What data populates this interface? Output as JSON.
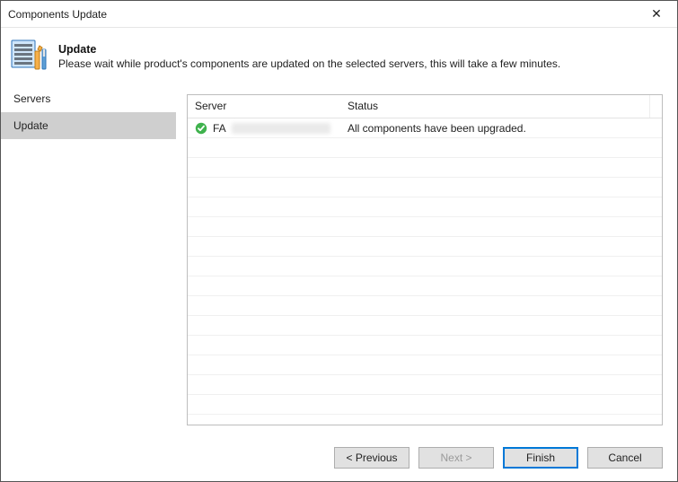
{
  "window": {
    "title": "Components Update"
  },
  "header": {
    "title": "Update",
    "subtitle": "Please wait while product's components are updated on the selected servers, this will take a few minutes."
  },
  "sidebar": {
    "items": [
      {
        "label": "Servers",
        "selected": false
      },
      {
        "label": "Update",
        "selected": true
      }
    ]
  },
  "grid": {
    "columns": {
      "server": "Server",
      "status": "Status"
    },
    "rows": [
      {
        "server_prefix": "FA",
        "server_obscured": true,
        "status": "All components have been upgraded.",
        "ok": true
      }
    ],
    "empty_row_count": 15
  },
  "footer": {
    "previous": "< Previous",
    "next": "Next >",
    "next_disabled": true,
    "finish": "Finish",
    "cancel": "Cancel"
  },
  "icons": {
    "close": "✕"
  }
}
